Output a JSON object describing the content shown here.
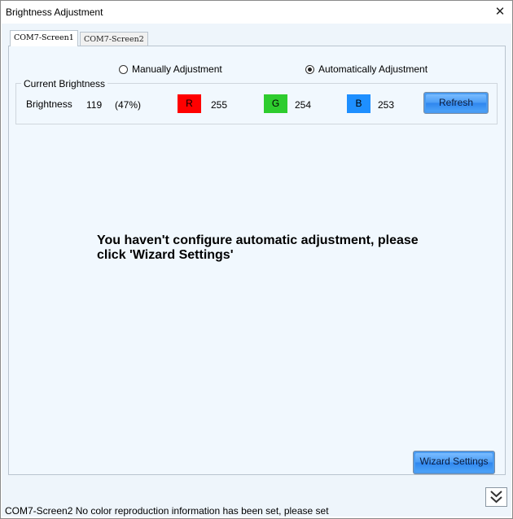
{
  "window": {
    "title": "Brightness Adjustment",
    "close_glyph": "✕"
  },
  "tabs": [
    {
      "label": "COM7-Screen1",
      "active": true
    },
    {
      "label": "COM7-Screen2",
      "active": false
    }
  ],
  "mode": {
    "manual_label": "Manually Adjustment",
    "auto_label": "Automatically Adjustment",
    "selected": "auto"
  },
  "current_brightness": {
    "group_title": "Current Brightness",
    "label": "Brightness",
    "value": "119",
    "percent": "(47%)",
    "channels": [
      {
        "name": "R",
        "value": "255",
        "color": "#ff0000"
      },
      {
        "name": "G",
        "value": "254",
        "color": "#2ecc2e"
      },
      {
        "name": "B",
        "value": "253",
        "color": "#1e8fff"
      }
    ],
    "refresh_label": "Refresh"
  },
  "message": "You haven't configure automatic adjustment, please click 'Wizard Settings'",
  "wizard_button_label": "Wizard Settings",
  "status_bar": "COM7-Screen2 No color reproduction information has been set, please set",
  "icons": {
    "expand": "double-chevron-down-icon",
    "close": "close-icon"
  }
}
